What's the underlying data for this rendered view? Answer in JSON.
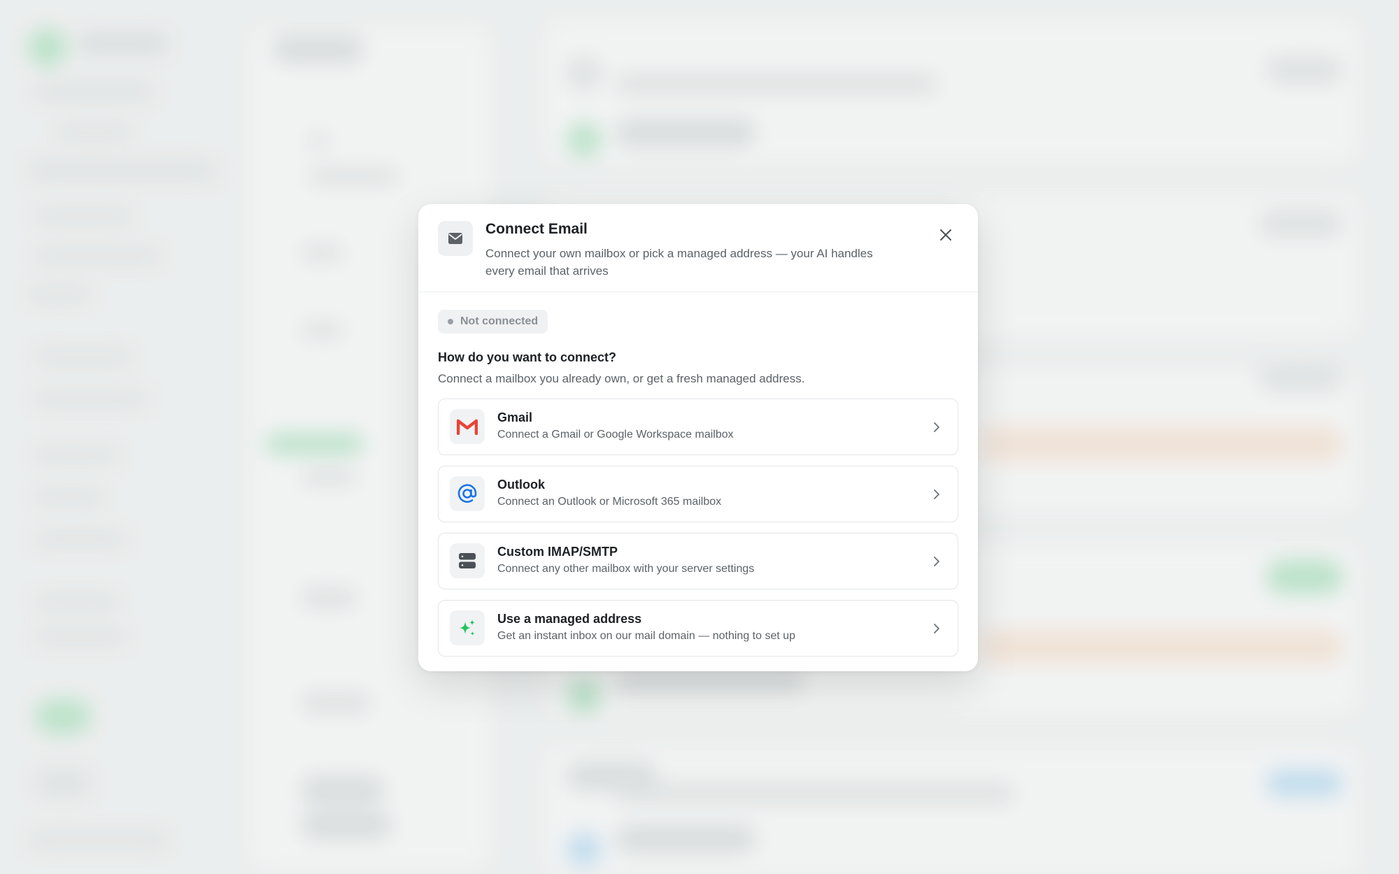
{
  "modal": {
    "title": "Connect Email",
    "subtitle": "Connect your own mailbox or pick a managed address — your AI handles every email that arrives",
    "status": "Not connected",
    "section_title": "How do you want to connect?",
    "section_desc": "Connect a mailbox you already own, or get a fresh managed address.",
    "options": [
      {
        "title": "Gmail",
        "desc": "Connect a Gmail or Google Workspace mailbox",
        "icon": "gmail-icon"
      },
      {
        "title": "Outlook",
        "desc": "Connect an Outlook or Microsoft 365 mailbox",
        "icon": "at-sign-icon"
      },
      {
        "title": "Custom IMAP/SMTP",
        "desc": "Connect any other mailbox with your server settings",
        "icon": "server-icon"
      },
      {
        "title": "Use a managed address",
        "desc": "Get an instant inbox on our mail domain — nothing to set up",
        "icon": "sparkles-icon"
      }
    ]
  },
  "colors": {
    "gmail_red": "#ea4335",
    "outlook_blue": "#1a73e8",
    "sparkle_green": "#22c55e",
    "text_primary": "#1d2125",
    "text_secondary": "#5c6268"
  }
}
